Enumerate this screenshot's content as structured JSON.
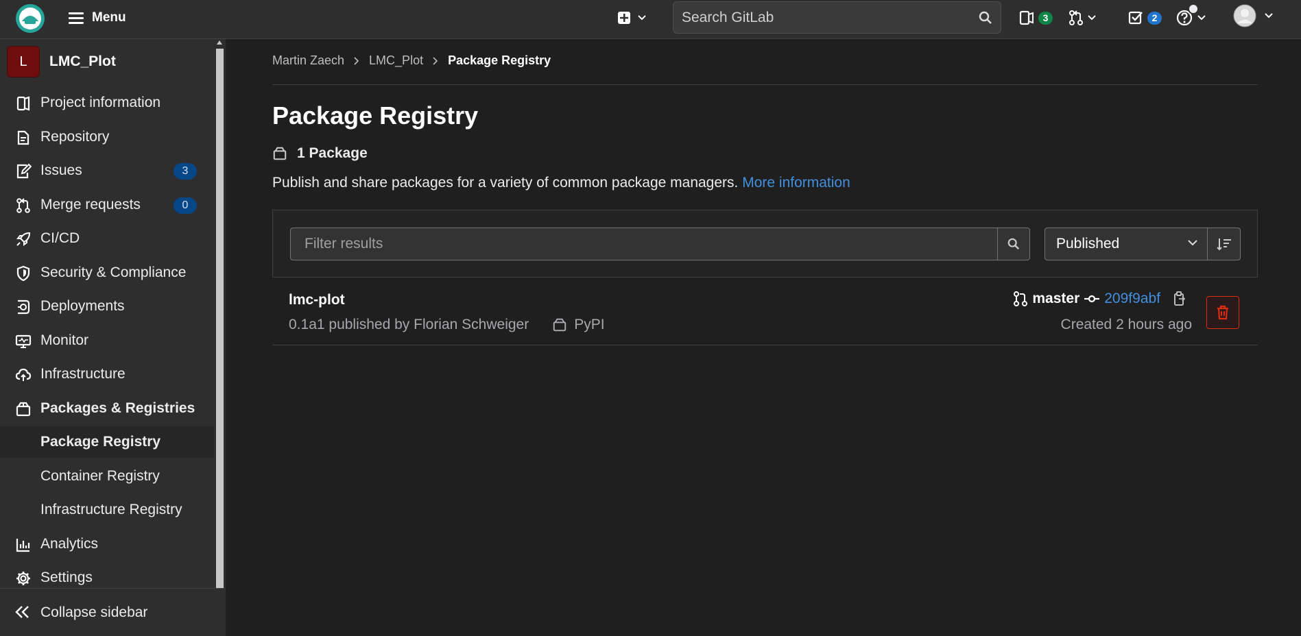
{
  "topbar": {
    "menu_label": "Menu",
    "search_placeholder": "Search GitLab",
    "issues_count": "3",
    "todos_count": "2"
  },
  "sidebar": {
    "project_initial": "L",
    "project_name": "LMC_Plot",
    "items": [
      {
        "label": "Project information",
        "icon": "project-info-icon"
      },
      {
        "label": "Repository",
        "icon": "document-icon"
      },
      {
        "label": "Issues",
        "icon": "issues-icon",
        "badge": "3"
      },
      {
        "label": "Merge requests",
        "icon": "merge-request-icon",
        "badge": "0"
      },
      {
        "label": "CI/CD",
        "icon": "rocket-icon"
      },
      {
        "label": "Security & Compliance",
        "icon": "shield-icon"
      },
      {
        "label": "Deployments",
        "icon": "deployments-icon"
      },
      {
        "label": "Monitor",
        "icon": "monitor-icon"
      },
      {
        "label": "Infrastructure",
        "icon": "cloud-icon"
      },
      {
        "label": "Packages & Registries",
        "icon": "package-icon"
      }
    ],
    "subitems": [
      "Package Registry",
      "Container Registry",
      "Infrastructure Registry"
    ],
    "bottom_items": [
      {
        "label": "Analytics",
        "icon": "chart-icon"
      },
      {
        "label": "Settings",
        "icon": "gear-icon"
      }
    ],
    "collapse_label": "Collapse sidebar"
  },
  "breadcrumb": [
    "Martin Zaech",
    "LMC_Plot",
    "Package Registry"
  ],
  "page": {
    "title": "Package Registry",
    "package_count": "1 Package",
    "description": "Publish and share packages for a variety of common package managers.",
    "more_info": "More information"
  },
  "filter": {
    "placeholder": "Filter results",
    "sort_value": "Published"
  },
  "packages": [
    {
      "name": "lmc-plot",
      "version_info": "0.1a1 published by Florian Schweiger",
      "type": "PyPI",
      "branch": "master",
      "commit": "209f9abf",
      "created": "Created 2 hours ago"
    }
  ],
  "colors": {
    "background": "#1f1f1f",
    "sidebar": "#2e2e2e",
    "link": "#428fdc",
    "danger": "#dd2b0e",
    "avatar": "#6d0d0d"
  }
}
